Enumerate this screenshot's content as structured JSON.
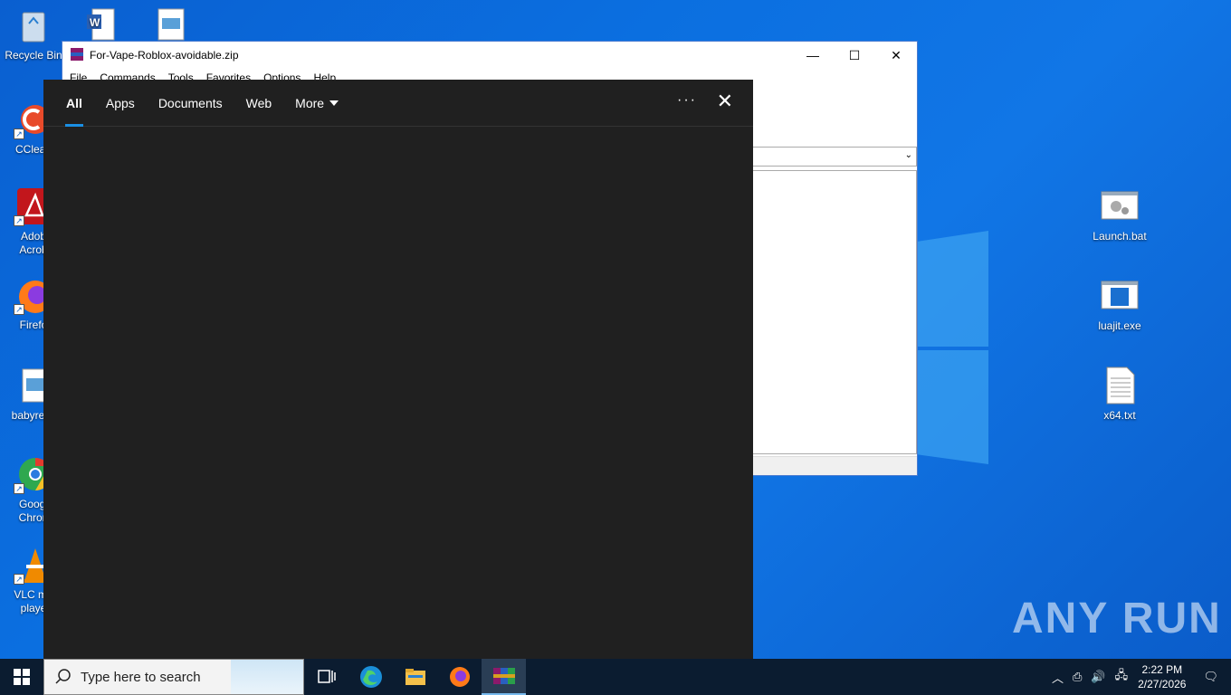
{
  "desktop": {
    "icons_left": [
      {
        "label": "Recycle Bin",
        "icon": "recycle-bin-icon"
      },
      {
        "label": "CClean",
        "icon": "ccleaner-icon"
      },
      {
        "label": "Adob Acrob",
        "icon": "acrobat-icon"
      },
      {
        "label": "Firefo",
        "icon": "firefox-icon"
      },
      {
        "label": "babyresc",
        "icon": "image-file-icon"
      },
      {
        "label": "Googl Chron",
        "icon": "chrome-icon"
      },
      {
        "label": "VLC me playe",
        "icon": "vlc-icon"
      }
    ],
    "icons_right": [
      {
        "label": "Launch.bat",
        "icon": "batch-file-icon"
      },
      {
        "label": "luajit.exe",
        "icon": "exe-file-icon"
      },
      {
        "label": "x64.txt",
        "icon": "text-file-icon"
      }
    ]
  },
  "winrar": {
    "title": "For-Vape-Roblox-avoidable.zip",
    "menu": [
      "File",
      "Commands",
      "Tools",
      "Favorites",
      "Options",
      "Help"
    ]
  },
  "search_panel": {
    "tabs": [
      "All",
      "Apps",
      "Documents",
      "Web",
      "More"
    ],
    "active_tab": "All"
  },
  "taskbar": {
    "search_placeholder": "Type here to search",
    "time": "2:22 PM",
    "date": "2/27/2026"
  },
  "watermark": "ANY RUN"
}
